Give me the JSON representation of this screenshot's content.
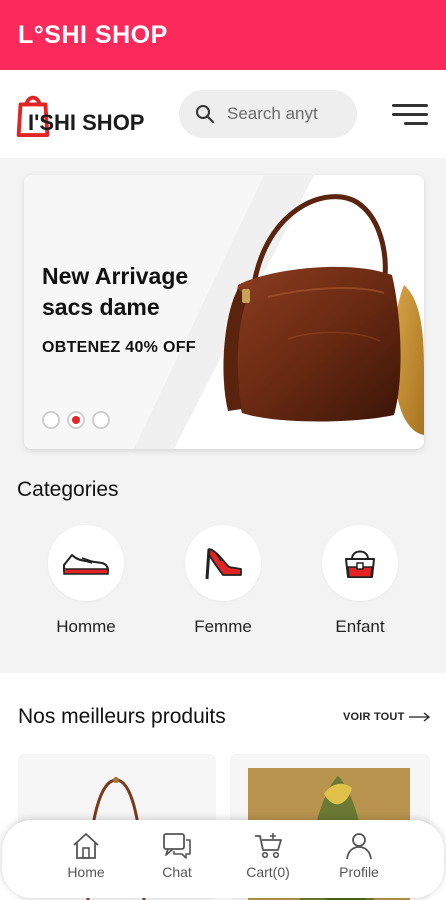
{
  "appbar": {
    "title": "L°SHI SHOP",
    "color": "#fb2a5a"
  },
  "header": {
    "logo_text": "I'SHI SHOP",
    "search_placeholder": "Search anyt"
  },
  "banner": {
    "title": "New Arrivage sacs dame",
    "subtitle": "OBTENEZ 40% OFF",
    "slides": 3,
    "active_slide": 2
  },
  "categories": {
    "title": "Categories",
    "items": [
      {
        "label": "Homme",
        "icon": "sneaker-icon"
      },
      {
        "label": "Femme",
        "icon": "high-heel-icon"
      },
      {
        "label": "Enfant",
        "icon": "handbag-icon"
      }
    ]
  },
  "products": {
    "title": "Nos meilleurs produits",
    "see_all": "VOIR TOUT"
  },
  "nav": {
    "items": [
      {
        "label": "Home",
        "icon": "home-icon"
      },
      {
        "label": "Chat",
        "icon": "chat-icon"
      },
      {
        "label": "Cart(0)",
        "icon": "cart-icon"
      },
      {
        "label": "Profile",
        "icon": "profile-icon"
      }
    ]
  },
  "colors": {
    "accent": "#fb2a5a",
    "red": "#e32424"
  }
}
